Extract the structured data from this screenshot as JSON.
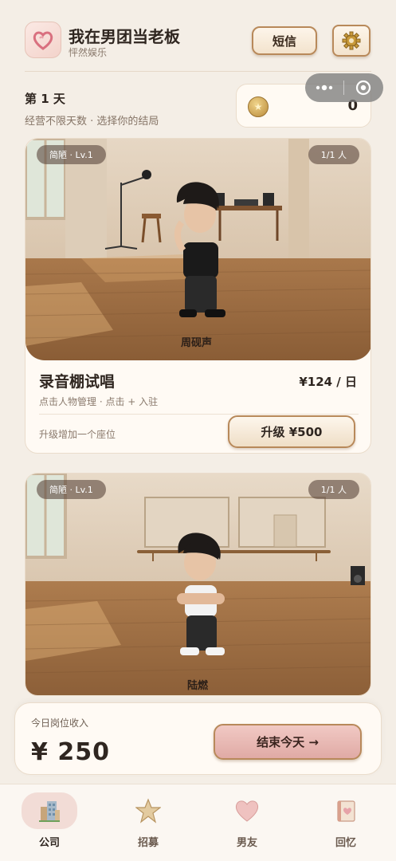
{
  "header": {
    "app_title": "我在男团当老板",
    "app_subtitle": "怦然娱乐",
    "sms_button": "短信",
    "settings_icon": "gear-icon"
  },
  "status": {
    "day_title": "第 1 天",
    "day_subtitle": "经营不限天数 · 选择你的结局",
    "coins": "0"
  },
  "rooms": [
    {
      "quality_tag": "简陋 · Lv.1",
      "occupancy": "1/1 人",
      "character_name": "周砚声",
      "title": "录音棚试唱",
      "income": "¥124 / 日",
      "hint": "点击人物管理 · 点击 + 入驻",
      "upgrade_hint": "升级增加一个座位",
      "upgrade_button": "升级 ¥500"
    },
    {
      "quality_tag": "简陋 · Lv.1",
      "occupancy": "1/1 人",
      "character_name": "陆燃"
    }
  ],
  "income_panel": {
    "label": "今日岗位收入",
    "value": "¥ 250",
    "end_day_button": "结束今天 →"
  },
  "tabs": [
    {
      "label": "公司",
      "icon": "company-building-icon",
      "active": true
    },
    {
      "label": "招募",
      "icon": "star-icon",
      "active": false
    },
    {
      "label": "男友",
      "icon": "heart-icon",
      "active": false
    },
    {
      "label": "回忆",
      "icon": "memory-album-icon",
      "active": false
    }
  ],
  "colors": {
    "background": "#f4eee6",
    "accent_border": "#b8895a",
    "end_day_button": "#e0aaa5"
  }
}
